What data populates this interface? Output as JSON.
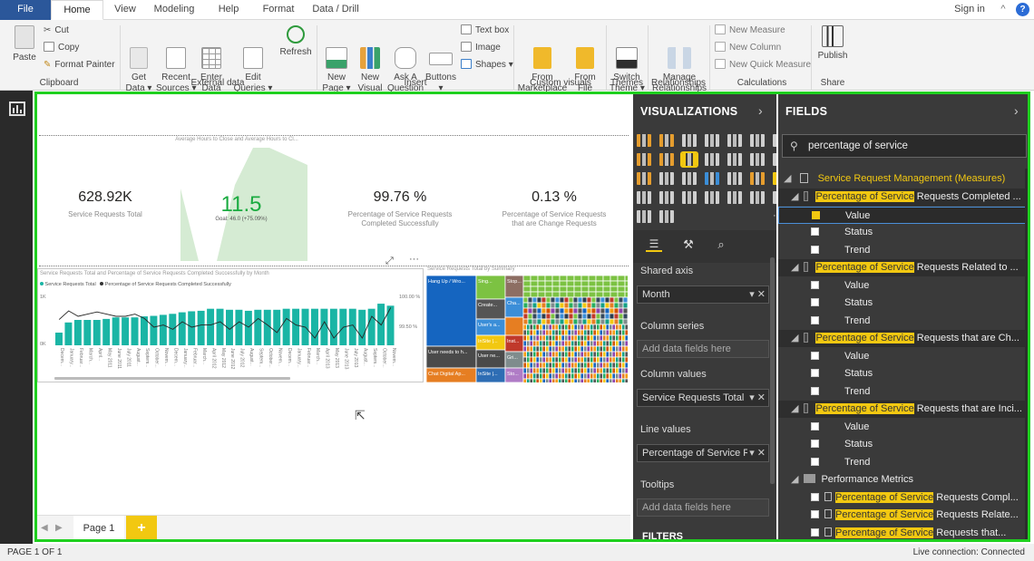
{
  "menu": {
    "file": "File",
    "tabs": [
      "Home",
      "View",
      "Modeling",
      "Help",
      "Format",
      "Data / Drill"
    ],
    "sign_in": "Sign in",
    "help": "?"
  },
  "ribbon": {
    "paste": "Paste",
    "cut": "Cut",
    "copy": "Copy",
    "format_painter": "Format Painter",
    "get_data": "Get\nData ▾",
    "recent_sources": "Recent\nSources ▾",
    "enter_data": "Enter\nData",
    "edit_queries": "Edit\nQueries ▾",
    "refresh": "Refresh",
    "new_page": "New\nPage ▾",
    "new_visual": "New\nVisual",
    "ask_question": "Ask A\nQuestion",
    "buttons": "Buttons\n▾",
    "text_box": "Text box",
    "image": "Image",
    "shapes": "Shapes ▾",
    "from_marketplace": "From\nMarketplace",
    "from_file": "From\nFile",
    "switch_theme": "Switch\nTheme ▾",
    "manage_relationships": "Manage\nRelationships",
    "new_measure": "New Measure",
    "new_column": "New Column",
    "new_quick_measure": "New Quick Measure",
    "publish": "Publish",
    "groups": {
      "clipboard": "Clipboard",
      "external_data": "External data",
      "insert": "Insert",
      "custom_visuals": "Custom visuals",
      "themes": "Themes",
      "relationships": "Relationships",
      "calculations": "Calculations",
      "share": "Share"
    }
  },
  "canvas": {
    "area_title": "Average Hours to Close and Average Hours to Cl...",
    "kpis": [
      {
        "value": "628.92K",
        "label": "Service Requests Total"
      },
      {
        "value": "11.5",
        "label": "Goal: 46.0 (+75.09%)"
      },
      {
        "value": "99.76 %",
        "label": "Percentage of Service Requests\nCompleted Successfully"
      },
      {
        "value": "0.13 %",
        "label": "Percentage of Service Requests\nthat are Change Requests"
      }
    ],
    "combo_title": "Service Requests Total and Percentage of Service Requests Completed Successfully by Month",
    "combo_legend": [
      "Service Requests Total",
      "Percentage of Service Requests Completed Successfully"
    ],
    "combo_y_left": [
      "1K",
      "0K"
    ],
    "combo_y_right": [
      "100.00 %",
      "99.50 %"
    ],
    "treemap_title": "Service Requests Total by Summary",
    "treemap_labels": [
      "Hang Up / Wro...",
      "User needs to h...",
      "Chat Digital Ap...",
      "Create...",
      "User's a...",
      "User ne...",
      "InSite |...",
      "Sing...",
      "Stop...",
      "Cha...",
      "Inst...",
      "Gri...",
      "Sto..."
    ],
    "page_tab": "Page 1",
    "add_page": "+"
  },
  "visualizations": {
    "title": "VISUALIZATIONS",
    "wells": [
      {
        "label": "Shared axis",
        "value": "Month"
      },
      {
        "label": "Column series",
        "value": "Add data fields here"
      },
      {
        "label": "Column values",
        "value": "Service Requests Total"
      },
      {
        "label": "Line values",
        "value": "Percentage of Service Re"
      },
      {
        "label": "Tooltips",
        "value": "Add data fields here"
      }
    ],
    "filters": "FILTERS"
  },
  "fields": {
    "title": "FIELDS",
    "search_value": "percentage of service",
    "table_name": "Service Request Management (Measures)",
    "kpis": [
      {
        "match": "Percentage of Service",
        "rest": " Requests Completed ..."
      },
      {
        "match": "Percentage of Service",
        "rest": " Requests Related to ..."
      },
      {
        "match": "Percentage of Service",
        "rest": " Requests that are Ch..."
      },
      {
        "match": "Percentage of Service",
        "rest": " Requests that are Inci..."
      }
    ],
    "kpi_children": [
      "Value",
      "Status",
      "Trend"
    ],
    "folder": "Performance Metrics",
    "measures": [
      {
        "match": "Percentage of Service",
        "rest": " Requests Compl..."
      },
      {
        "match": "Percentage of Service",
        "rest": " Requests Relate..."
      },
      {
        "match": "Percentage of Service",
        "rest": " Requests that..."
      }
    ]
  },
  "status": {
    "page": "PAGE 1 OF 1",
    "connection": "Live connection: Connected"
  },
  "chart_data": {
    "type": "bar",
    "title": "Service Requests Total and Percentage of Service Requests Completed Successfully by Month",
    "categories": [
      "Decem...",
      "January...",
      "Februar...",
      "March...",
      "April...",
      "May 2011",
      "June 2011",
      "July 2011",
      "August...",
      "Septem...",
      "October...",
      "Novem...",
      "Decem...",
      "January...",
      "Februar...",
      "March...",
      "April 2012",
      "May 2012",
      "June 2012",
      "July 2012",
      "August...",
      "Septem...",
      "October...",
      "Novem...",
      "Decem...",
      "January...",
      "Februar...",
      "March...",
      "April 2013",
      "May 2013",
      "June 2013",
      "July 2013",
      "August...",
      "Septem...",
      "October...",
      "Novem..."
    ],
    "series": [
      {
        "name": "Service Requests Total",
        "values": [
          0.25,
          0.45,
          0.5,
          0.5,
          0.5,
          0.52,
          0.55,
          0.55,
          0.55,
          0.57,
          0.58,
          0.6,
          0.62,
          0.65,
          0.67,
          0.68,
          0.72,
          0.72,
          0.7,
          0.7,
          0.68,
          0.7,
          0.7,
          0.7,
          0.72,
          0.72,
          0.72,
          0.72,
          0.72,
          0.72,
          0.72,
          0.72,
          0.7,
          0.72,
          0.82,
          0.78
        ]
      },
      {
        "name": "Percentage of Service Requests Completed Successfully",
        "values": [
          99.77,
          99.85,
          99.8,
          99.82,
          99.84,
          99.82,
          99.8,
          99.8,
          99.82,
          99.78,
          99.7,
          99.72,
          99.68,
          99.75,
          99.7,
          99.72,
          99.72,
          99.75,
          99.68,
          99.75,
          99.7,
          99.78,
          99.72,
          99.65,
          99.78,
          99.72,
          99.7,
          99.6,
          99.75,
          99.6,
          99.7,
          99.72,
          99.6,
          99.8,
          99.72,
          99.88
        ]
      }
    ],
    "ylim": [
      0,
      1
    ],
    "y2lim": [
      99.5,
      100.0
    ]
  }
}
